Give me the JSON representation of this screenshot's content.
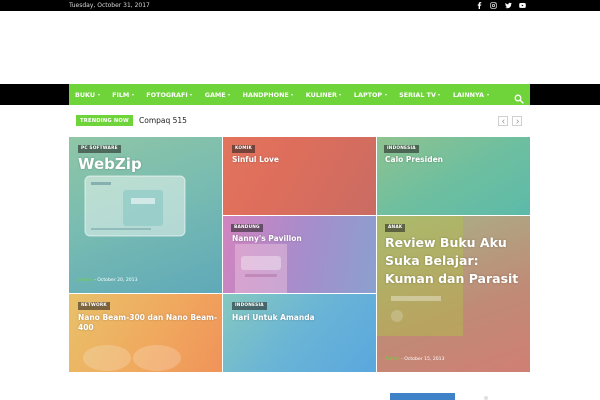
{
  "topbar": {
    "date": "Tuesday, October 31, 2017",
    "social": [
      {
        "name": "facebook-icon"
      },
      {
        "name": "instagram-icon"
      },
      {
        "name": "twitter-icon"
      },
      {
        "name": "youtube-icon"
      }
    ]
  },
  "nav": {
    "items": [
      {
        "label": "BUKU"
      },
      {
        "label": "FILM"
      },
      {
        "label": "FOTOGRAFI"
      },
      {
        "label": "GAME"
      },
      {
        "label": "HANDPHONE"
      },
      {
        "label": "KULINER"
      },
      {
        "label": "LAPTOP"
      },
      {
        "label": "SERIAL TV"
      },
      {
        "label": "LAINNYA"
      }
    ],
    "search_icon": "search-icon",
    "accent_color": "#6fd33a"
  },
  "trending": {
    "badge": "TRENDING NOW",
    "title": "Compaq 515"
  },
  "tiles": [
    {
      "category": "PC SOFTWARE",
      "title": "WebZip",
      "author": "Admin",
      "date": "October 20, 2013"
    },
    {
      "category": "KOMIK",
      "title": "Sinful Love"
    },
    {
      "category": "INDONESIA",
      "title": "Calo Presiden"
    },
    {
      "category": "BANDUNG",
      "title": "Nanny's Pavillon"
    },
    {
      "category": "ANAK",
      "title": "Review Buku Aku Suka Belajar: Kuman dan Parasit",
      "author": "Admin",
      "date": "October 15, 2013"
    },
    {
      "category": "NETWORK",
      "title": "Nano Beam-300 dan Nano Beam-400"
    },
    {
      "category": "INDONESIA",
      "title": "Hari Untuk Amanda"
    }
  ]
}
